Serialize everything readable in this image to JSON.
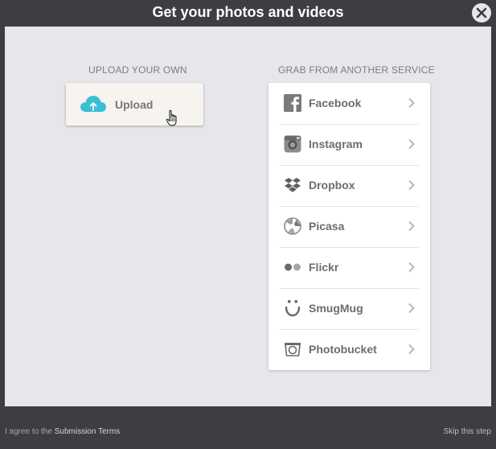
{
  "dialog": {
    "title": "Get your photos and videos"
  },
  "upload_section": {
    "heading": "UPLOAD YOUR OWN",
    "button_label": "Upload",
    "icon": "cloud-upload-icon"
  },
  "services_section": {
    "heading": "GRAB FROM ANOTHER SERVICE",
    "items": [
      {
        "label": "Facebook",
        "icon": "facebook-icon"
      },
      {
        "label": "Instagram",
        "icon": "instagram-icon"
      },
      {
        "label": "Dropbox",
        "icon": "dropbox-icon"
      },
      {
        "label": "Picasa",
        "icon": "picasa-icon"
      },
      {
        "label": "Flickr",
        "icon": "flickr-icon"
      },
      {
        "label": "SmugMug",
        "icon": "smugmug-icon"
      },
      {
        "label": "Photobucket",
        "icon": "photobucket-icon"
      }
    ]
  },
  "footer": {
    "agree_prefix": "I agree to the ",
    "terms_link": "Submission Terms",
    "skip_label": "Skip this step"
  },
  "colors": {
    "frame": "#3e3d42",
    "content_bg": "#e6e7ea",
    "accent_cloud": "#3bbfd5",
    "text_gray": "#6d6d6d"
  }
}
